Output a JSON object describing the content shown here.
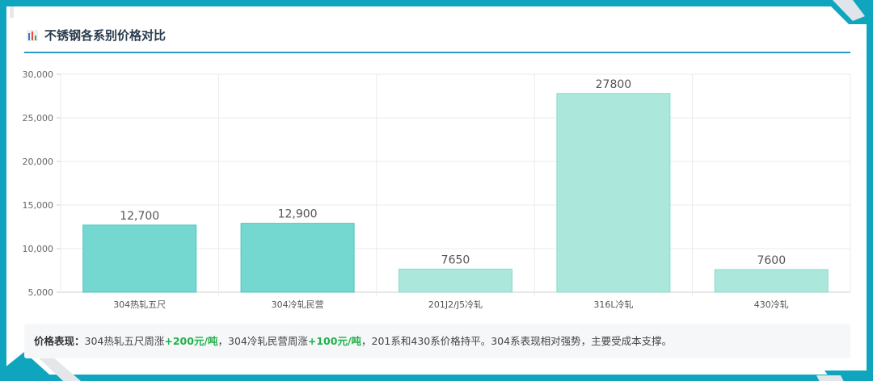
{
  "header": {
    "title": "不锈钢各系别价格对比"
  },
  "chart_data": {
    "type": "bar",
    "title": "不锈钢各系别价格对比",
    "xlabel": "",
    "ylabel": "",
    "categories": [
      "304热轧五尺",
      "304冷轧民营",
      "201J2/J5冷轧",
      "316L冷轧",
      "430冷轧"
    ],
    "values": [
      12700,
      12900,
      7650,
      27800,
      7600
    ],
    "value_labels": [
      "12,700",
      "12,900",
      "7650",
      "27800",
      "7600"
    ],
    "ylim": [
      5000,
      30000
    ],
    "yticks": [
      5000,
      10000,
      15000,
      20000,
      25000,
      30000
    ],
    "ytick_labels": [
      "5,000",
      "10,000",
      "15,000",
      "20,000",
      "25,000",
      "30,000"
    ],
    "grid": true,
    "colors": [
      "#75d8d0",
      "#75d8d0",
      "#abe7db",
      "#abe7db",
      "#abe7db"
    ],
    "edge_colors": [
      "#4cc4bb",
      "#4cc4bb",
      "#88dccb",
      "#88dccb",
      "#88dccb"
    ]
  },
  "note": {
    "label": "价格表现：",
    "part1": "304热轧五尺周涨",
    "up1": "+200元/吨",
    "part2": "，304冷轧民营周涨",
    "up2": "+100元/吨",
    "part3": "，201系和430系价格持平。304系表现相对强势，主要受成本支撑。"
  },
  "colors": {
    "frame": "#0fa5bf",
    "header_rule": "#2e97c9",
    "increase": "#21b04b"
  }
}
